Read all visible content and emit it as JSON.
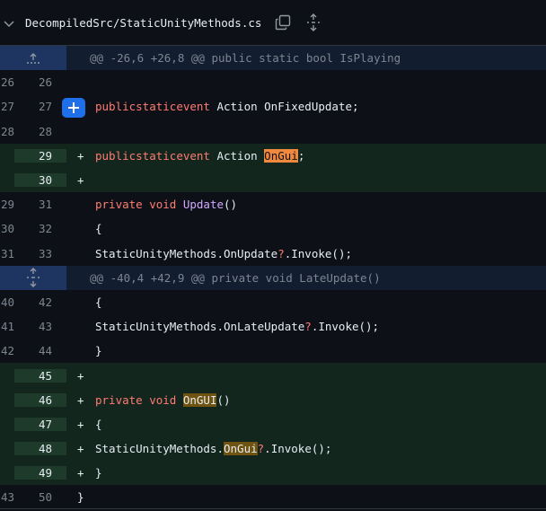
{
  "header": {
    "filename": "DecompiledSrc/StaticUnityMethods.cs",
    "icons": [
      "chevron-down-icon",
      "copy-icon",
      "expand-all-icon"
    ]
  },
  "hunks": [
    {
      "text": "@@ -26,6 +26,8 @@ public static bool IsPlaying"
    },
    {
      "text": "@@ -40,4 +42,9 @@ private void LateUpdate()"
    }
  ],
  "lines": [
    {
      "old": "26",
      "new": "26",
      "type": "ctx"
    },
    {
      "old": "27",
      "new": "27",
      "type": "ctx"
    },
    {
      "old": "28",
      "new": "28",
      "type": "ctx"
    },
    {
      "old": "",
      "new": "29",
      "type": "add",
      "marker": "+"
    },
    {
      "old": "",
      "new": "30",
      "type": "add",
      "marker": "+"
    },
    {
      "old": "29",
      "new": "31",
      "type": "ctx"
    },
    {
      "old": "30",
      "new": "32",
      "type": "ctx"
    },
    {
      "old": "31",
      "new": "33",
      "type": "ctx"
    },
    {
      "old": "40",
      "new": "42",
      "type": "ctx"
    },
    {
      "old": "41",
      "new": "43",
      "type": "ctx"
    },
    {
      "old": "42",
      "new": "44",
      "type": "ctx"
    },
    {
      "old": "",
      "new": "45",
      "type": "add",
      "marker": "+"
    },
    {
      "old": "",
      "new": "46",
      "type": "add",
      "marker": "+"
    },
    {
      "old": "",
      "new": "47",
      "type": "add",
      "marker": "+"
    },
    {
      "old": "",
      "new": "48",
      "type": "add",
      "marker": "+"
    },
    {
      "old": "",
      "new": "49",
      "type": "add",
      "marker": "+"
    },
    {
      "old": "43",
      "new": "50",
      "type": "ctx"
    }
  ],
  "code": {
    "l27": {
      "a": "public",
      "b": "static",
      "c": "event",
      "d": " Action OnFixedUpdate;"
    },
    "l29": {
      "a": "public",
      "b": "static",
      "c": "event",
      "d": " Action ",
      "e": "OnGui",
      "f": ";"
    },
    "l31": {
      "a": "private",
      "b": " void ",
      "c": "Update",
      "d": "()"
    },
    "l32": "{",
    "l33": {
      "a": "StaticUnityMethods.OnUpdate",
      "b": "?",
      "c": ".Invoke();"
    },
    "l42": "{",
    "l43": {
      "a": "StaticUnityMethods.OnLateUpdate",
      "b": "?",
      "c": ".Invoke();"
    },
    "l44": "}",
    "l46": {
      "a": "private",
      "b": " void ",
      "c": "OnGUI",
      "d": "()"
    },
    "l47": "{",
    "l48": {
      "a": "StaticUnityMethods.",
      "b": "OnGui",
      "c": "?",
      "d": ".Invoke();"
    },
    "l49": "}",
    "l50": "}"
  },
  "colors": {
    "background": "#0d1117",
    "hunk_bg": "#121d2f",
    "hunk_gutter": "#1e3461",
    "add_bg": "#12261e",
    "add_gutter": "#1e3a2b",
    "keyword": "#ff7b72",
    "function": "#d2a8ff",
    "accent_button": "#1f6feb"
  }
}
